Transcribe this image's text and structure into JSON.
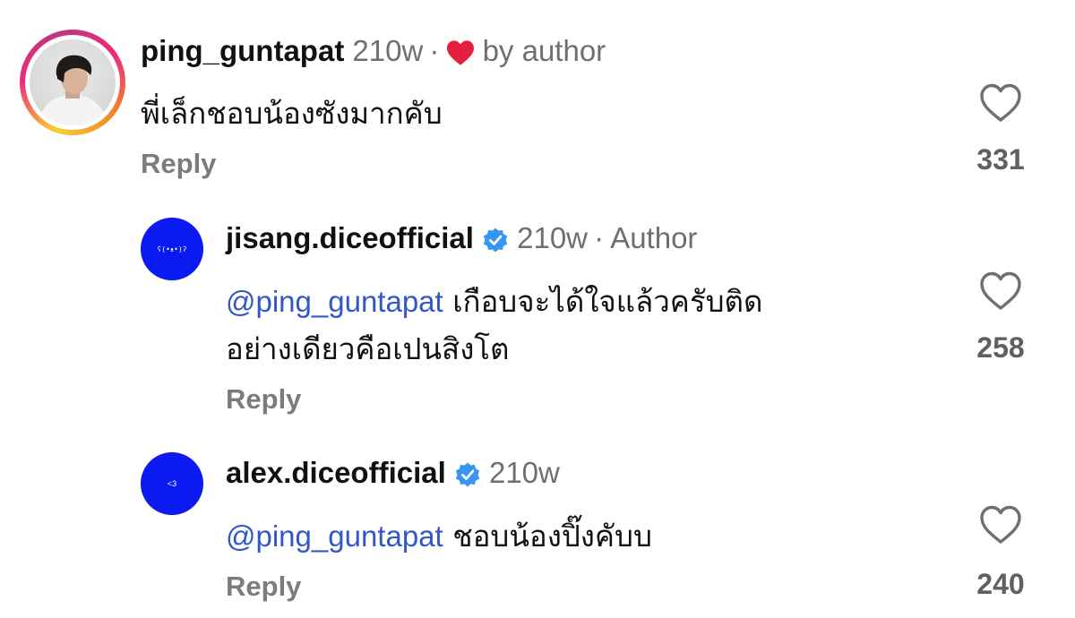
{
  "comments": [
    {
      "username": "ping_guntapat",
      "time": "210w",
      "separator": "·",
      "liked_by": "by author",
      "text": "พี่เล็กชอบน้องซังมากคับ",
      "reply_label": "Reply",
      "likes": "331"
    },
    {
      "username": "jisang.diceofficial",
      "verified": true,
      "avatar_text": "ʕ(•ᴥ•)ʔ",
      "time": "210w",
      "separator": "·",
      "author_badge": "Author",
      "mention": "@ping_guntapat",
      "text_line1": "เกือบจะได้ใจแล้วครับติด",
      "text_line2": "อย่างเดียวคือเปนสิงโต",
      "reply_label": "Reply",
      "likes": "258"
    },
    {
      "username": "alex.diceofficial",
      "verified": true,
      "avatar_text": "<3",
      "time": "210w",
      "mention": "@ping_guntapat",
      "text": "ชอบน้องปิ๊งคับบ",
      "reply_label": "Reply",
      "likes": "240"
    }
  ],
  "colors": {
    "heart_liked": "#e41e3f",
    "verified_blue": "#3797f0",
    "mention_blue": "#3457c8",
    "avatar_blue": "#0a1af0"
  },
  "icons": {
    "like": "heart-outline-icon",
    "liked_by_author": "heart-filled-icon",
    "verified": "verified-badge-icon"
  }
}
